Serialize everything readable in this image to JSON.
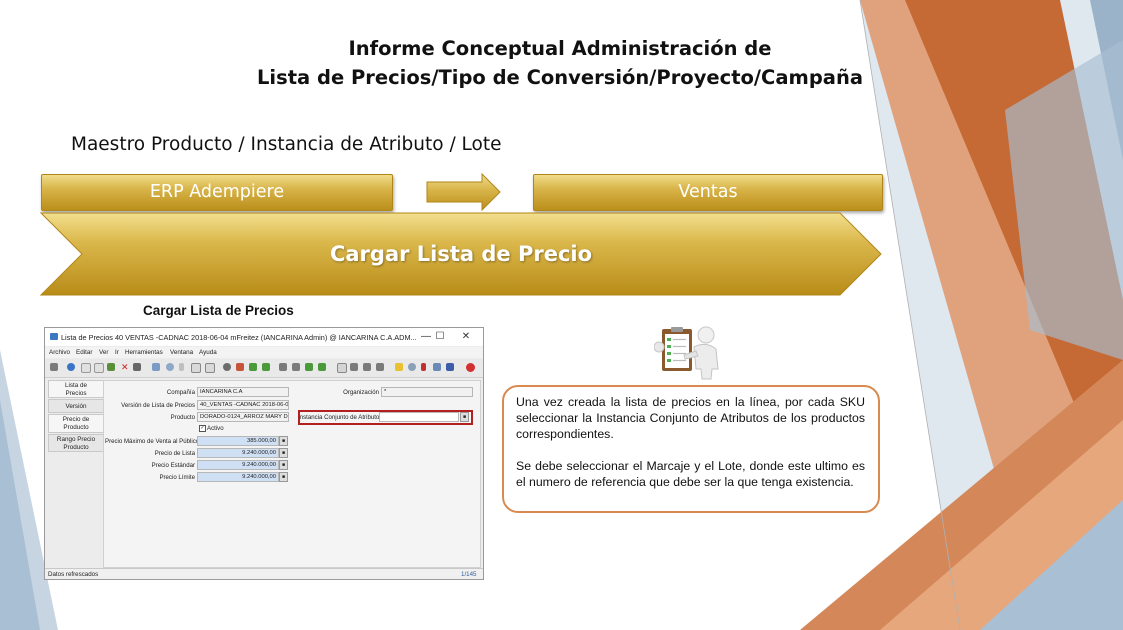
{
  "slide": {
    "title_line1": "Informe Conceptual Administración de",
    "title_line2": "Lista de Precios/Tipo de Conversión/Proyecto/Campaña",
    "subtitle": "Maestro Producto / Instancia de Atributo / Lote",
    "flow": {
      "left_label": "ERP Adempiere",
      "right_label": "Ventas",
      "banner_label": "Cargar Lista de Precio"
    },
    "screenshot_caption": "Cargar Lista de Precios",
    "callout": {
      "paragraph1": "Una vez creada la lista de precios en la línea, por cada SKU seleccionar la Instancia Conjunto de Atributos de los productos correspondientes.",
      "paragraph2": "Se debe seleccionar el Marcaje y el Lote, donde este ultimo es el numero de referencia que debe ser la que tenga existencia."
    },
    "colors": {
      "gold": "#c9a032",
      "callout_border": "#d98a50",
      "highlight_box": "#b32020",
      "deco_orange": "#c66a35",
      "deco_blue": "#9ab3c9"
    }
  },
  "app_window": {
    "title": "Lista de Precios  40  VENTAS -CADNAC 2018-06-04  mFreitez (IANCARINA Admin) @ IANCARINA C.A.ADM...",
    "menu": [
      "Archivo",
      "Editar",
      "Ver",
      "Ir",
      "Herramientas",
      "Ventana",
      "Ayuda"
    ],
    "tabs": [
      "Lista de Precios",
      "Versión",
      "Precio de Producto",
      "Rango Precio Producto"
    ],
    "fields": {
      "compania_label": "Compañía",
      "compania_value": "IANCARINA C.A",
      "organizacion_label": "Organización",
      "organizacion_value": "*",
      "version_label": "Versión de Lista de Precios",
      "version_value": "40_VENTAS -CADNAC 2018-06-04",
      "producto_label": "Producto",
      "producto_value": "DORADO-0124_ARROZ MARY DO",
      "instancia_label": "Instancia Conjunto de Atributos",
      "instancia_value": "",
      "activo_label": "Activo",
      "precio_max_label": "Precio Máximo de Venta al Público",
      "precio_max_value": "385.000,00",
      "precio_lista_label": "Precio de Lista",
      "precio_lista_value": "9.240.000,00",
      "precio_estandar_label": "Precio Estándar",
      "precio_estandar_value": "9.240.000,00",
      "precio_limite_label": "Precio Límite",
      "precio_limite_value": "9.240.000,00"
    },
    "status_text": "Datos refrescados",
    "record_count": "1/145"
  }
}
